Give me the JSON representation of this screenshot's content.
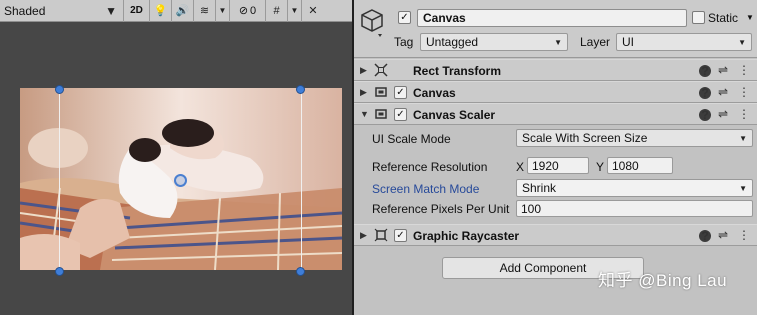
{
  "scene_toolbar": {
    "shading_mode": "Shaded",
    "mode_2d_label": "2D",
    "hidden_count": "0",
    "icons": [
      "lightbulb-icon",
      "audio-icon",
      "effects-icon",
      "visibility-icon",
      "grid-icon",
      "tools-icon"
    ]
  },
  "inspector": {
    "gameobject": {
      "name": "Canvas",
      "active": true,
      "static_label": "Static",
      "static": false,
      "tag_label": "Tag",
      "tag_value": "Untagged",
      "layer_label": "Layer",
      "layer_value": "UI"
    },
    "components": [
      {
        "title": "Rect Transform",
        "expanded": false,
        "has_checkbox": false
      },
      {
        "title": "Canvas",
        "expanded": false,
        "has_checkbox": true,
        "enabled": true
      },
      {
        "title": "Canvas Scaler",
        "expanded": true,
        "has_checkbox": true,
        "enabled": true
      },
      {
        "title": "Graphic Raycaster",
        "expanded": false,
        "has_checkbox": true,
        "enabled": true
      }
    ],
    "canvas_scaler": {
      "ui_scale_mode_label": "UI Scale Mode",
      "ui_scale_mode_value": "Scale With Screen Size",
      "reference_resolution_label": "Reference Resolution",
      "x_label": "X",
      "x_value": "1920",
      "y_label": "Y",
      "y_value": "1080",
      "screen_match_mode_label": "Screen Match Mode",
      "screen_match_mode_value": "Shrink",
      "ref_pixels_label": "Reference Pixels Per Unit",
      "ref_pixels_value": "100"
    },
    "add_component_label": "Add Component"
  },
  "watermark": "知乎 @Bing Lau",
  "colors": {
    "scene_bg": "#474747",
    "inspector_bg": "#c2c2c2",
    "handle_blue": "#3f7ed8",
    "label_blue": "#274a9a"
  }
}
